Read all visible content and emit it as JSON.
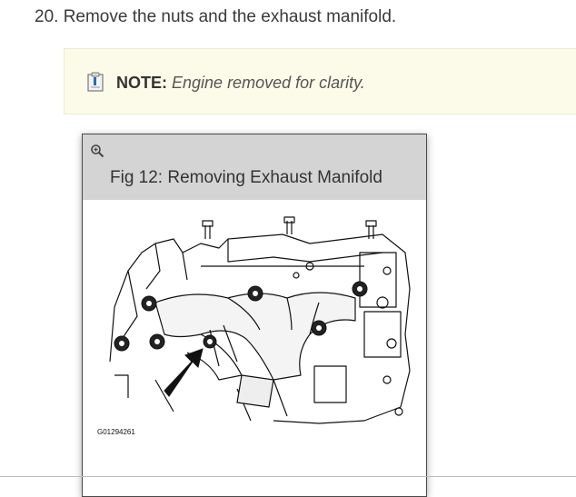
{
  "step": {
    "text": "20. Remove the nuts and the exhaust manifold."
  },
  "note": {
    "icon": "clipboard-note-icon",
    "label": "NOTE:",
    "text": "Engine removed for clarity."
  },
  "figure": {
    "zoom_icon": "zoom-in-icon",
    "title": "Fig 12: Removing Exhaust Manifold",
    "code": "G01294261"
  }
}
